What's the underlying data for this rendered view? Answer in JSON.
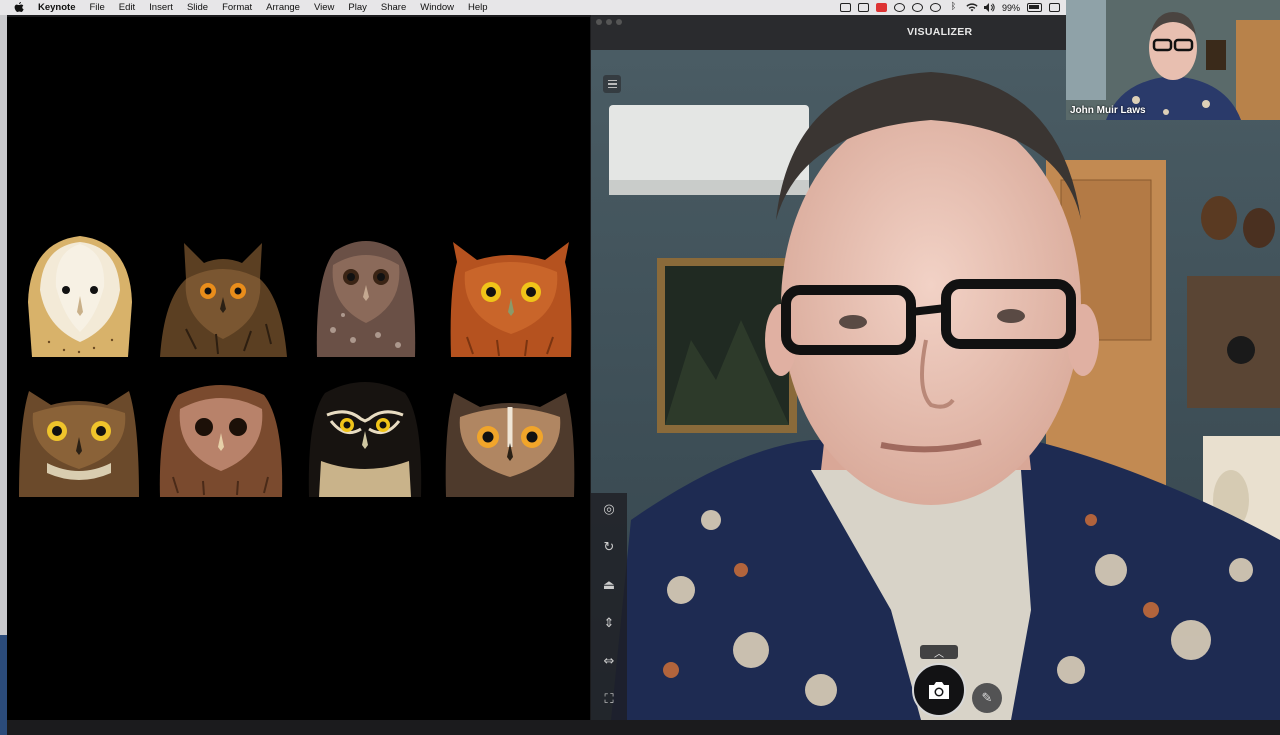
{
  "menubar": {
    "app_name": "Keynote",
    "items": [
      "File",
      "Edit",
      "Insert",
      "Slide",
      "Format",
      "Arrange",
      "View",
      "Play",
      "Share",
      "Window",
      "Help"
    ],
    "battery": "99%"
  },
  "visualizer": {
    "title": "VISUALIZER"
  },
  "thumbnail": {
    "name": "John Muir Laws"
  },
  "owls": [
    {
      "name": "barn-owl"
    },
    {
      "name": "eurasian-eagle-owl"
    },
    {
      "name": "mottled-owl"
    },
    {
      "name": "screech-owl"
    },
    {
      "name": "great-horned-owl"
    },
    {
      "name": "tawny-owl"
    },
    {
      "name": "spectacled-owl"
    },
    {
      "name": "long-eared-owl"
    }
  ],
  "colors": {
    "slide_bg": "#000000",
    "menubar_bg": "#e7e6e8",
    "visualizer_titlebar": "#2a2b2e"
  }
}
